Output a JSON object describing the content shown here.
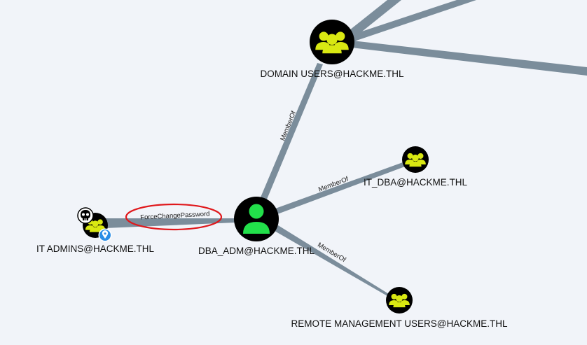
{
  "colors": {
    "background": "#f1f4f9",
    "edge": "#7b8d9b",
    "node_fill": "#000000",
    "group_icon": "#d9e812",
    "user_icon": "#22e04a",
    "highlight_ellipse": "#e0181c",
    "owned_badge": "#2a8ee6"
  },
  "nodes": {
    "domain_users": {
      "label": "DOMAIN USERS@HACKME.THL",
      "type": "group",
      "icon": "group-icon"
    },
    "it_dba": {
      "label": "IT_DBA@HACKME.THL",
      "type": "group",
      "icon": "group-icon"
    },
    "dba_adm": {
      "label": "DBA_ADM@HACKME.THL",
      "type": "user",
      "icon": "user-icon"
    },
    "it_admins": {
      "label": "IT ADMINS@HACKME.THL",
      "type": "group",
      "icon": "group-icon",
      "badges": [
        "skull-icon",
        "location-pin-icon"
      ]
    },
    "remote_mgmt": {
      "label": "REMOTE MANAGEMENT USERS@HACKME.THL",
      "type": "group",
      "icon": "group-icon"
    }
  },
  "edges": {
    "dba_to_domain_users": {
      "label": "MemberOf"
    },
    "dba_to_it_dba": {
      "label": "MemberOf"
    },
    "dba_to_remote_mgmt": {
      "label": "MemberOf"
    },
    "it_admins_to_dba": {
      "label": "ForceChangePassword",
      "highlighted": true
    }
  }
}
